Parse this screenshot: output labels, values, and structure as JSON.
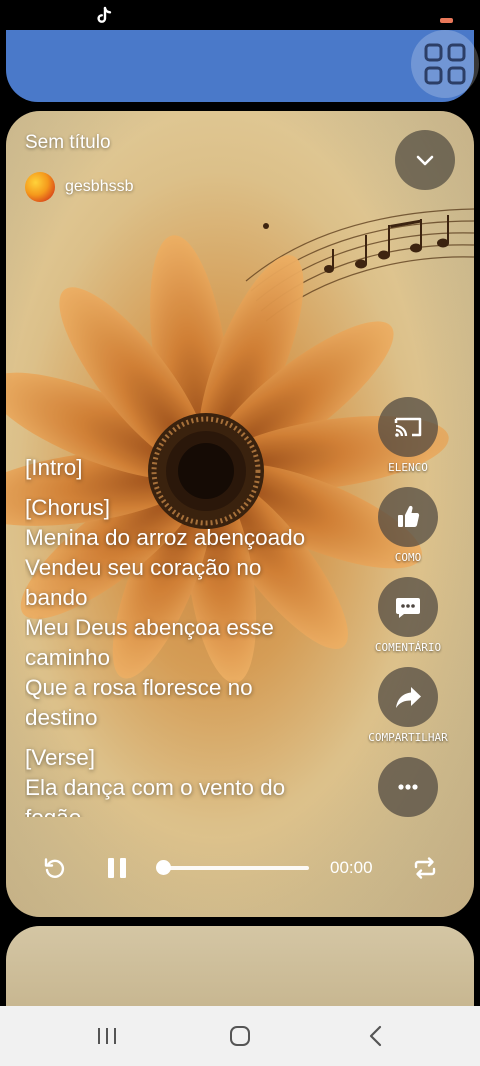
{
  "track": {
    "title": "Sem título",
    "artist": "gesbhssb"
  },
  "lyrics": [
    {
      "type": "section",
      "text": "[Intro]"
    },
    {
      "type": "gap"
    },
    {
      "type": "section",
      "text": "[Chorus]"
    },
    {
      "type": "line",
      "text": "Menina do arroz abençoado"
    },
    {
      "type": "line",
      "text": "Vendeu seu coração no"
    },
    {
      "type": "line",
      "text": "bando"
    },
    {
      "type": "line",
      "text": "Meu Deus abençoa esse"
    },
    {
      "type": "line",
      "text": "caminho"
    },
    {
      "type": "line",
      "text": "Que a rosa floresce no"
    },
    {
      "type": "line",
      "text": "destino"
    },
    {
      "type": "gap"
    },
    {
      "type": "section",
      "text": "[Verse]"
    },
    {
      "type": "line",
      "text": "Ela dança com o vento do"
    },
    {
      "type": "line",
      "text": "fogão"
    }
  ],
  "actions": [
    {
      "label": "ELENCO",
      "icon": "cast-icon"
    },
    {
      "label": "COMO",
      "icon": "thumbs-up-icon"
    },
    {
      "label": "COMENTÁRIO",
      "icon": "comment-icon"
    },
    {
      "label": "COMPARTILHAR",
      "icon": "share-icon"
    },
    {
      "label": "",
      "icon": "more-icon"
    }
  ],
  "player": {
    "current_time": "00:00",
    "progress": 0,
    "state": "playing"
  },
  "colors": {
    "top_card": "#4a79c9",
    "card_background": "#dcc089",
    "nav_bar": "#f1f1f1"
  }
}
